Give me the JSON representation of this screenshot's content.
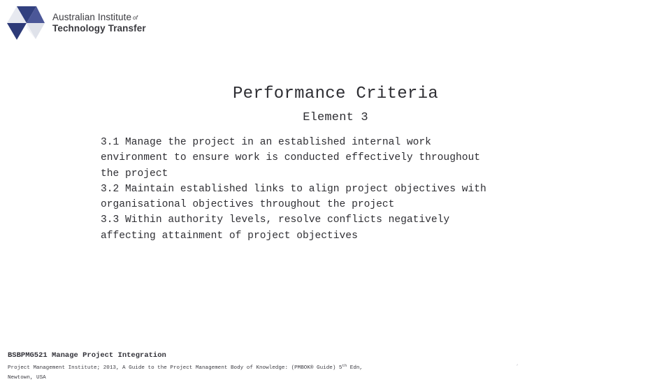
{
  "brand": {
    "logo_icon": "aitt-hexagon-triangles-logo",
    "name_line1": "Australian Institute",
    "name_of": "of",
    "name_line2": "Technology Transfer",
    "color_dark": "#2d3a78",
    "color_mid": "#3b4a90",
    "color_light": "#dfe1ea",
    "color_text": "#3a3a3f"
  },
  "slide": {
    "title": "Performance Criteria",
    "subtitle": "Element 3",
    "body_lines": [
      "3.1 Manage the project in an established internal work",
      "environment to ensure work is conducted effectively throughout",
      "the project",
      "3.2 Maintain established links to align project objectives with",
      "organisational objectives throughout the project",
      "3.3 Within authority levels, resolve conflicts negatively",
      "affecting attainment of project objectives"
    ],
    "text_color": "#2e2e33"
  },
  "footer": {
    "course_code_title": "BSBPMG521 Manage Project Integration",
    "citation_part1": "Project Management Institute; 2013, A Guide to the Project Management Body of Knowledge: (PMBOK® Guide) 5",
    "citation_sup": "th",
    "citation_part2": " Edn,",
    "citation_line2": "Newtown, USA",
    "corner_mark": "’"
  }
}
